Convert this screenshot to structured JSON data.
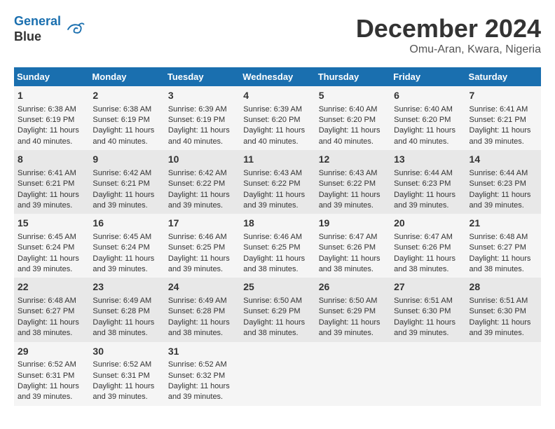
{
  "header": {
    "logo_line1": "General",
    "logo_line2": "Blue",
    "month": "December 2024",
    "location": "Omu-Aran, Kwara, Nigeria"
  },
  "days_of_week": [
    "Sunday",
    "Monday",
    "Tuesday",
    "Wednesday",
    "Thursday",
    "Friday",
    "Saturday"
  ],
  "weeks": [
    [
      {
        "day": "1",
        "lines": [
          "Sunrise: 6:38 AM",
          "Sunset: 6:19 PM",
          "Daylight: 11 hours",
          "and 40 minutes."
        ]
      },
      {
        "day": "2",
        "lines": [
          "Sunrise: 6:38 AM",
          "Sunset: 6:19 PM",
          "Daylight: 11 hours",
          "and 40 minutes."
        ]
      },
      {
        "day": "3",
        "lines": [
          "Sunrise: 6:39 AM",
          "Sunset: 6:19 PM",
          "Daylight: 11 hours",
          "and 40 minutes."
        ]
      },
      {
        "day": "4",
        "lines": [
          "Sunrise: 6:39 AM",
          "Sunset: 6:20 PM",
          "Daylight: 11 hours",
          "and 40 minutes."
        ]
      },
      {
        "day": "5",
        "lines": [
          "Sunrise: 6:40 AM",
          "Sunset: 6:20 PM",
          "Daylight: 11 hours",
          "and 40 minutes."
        ]
      },
      {
        "day": "6",
        "lines": [
          "Sunrise: 6:40 AM",
          "Sunset: 6:20 PM",
          "Daylight: 11 hours",
          "and 40 minutes."
        ]
      },
      {
        "day": "7",
        "lines": [
          "Sunrise: 6:41 AM",
          "Sunset: 6:21 PM",
          "Daylight: 11 hours",
          "and 39 minutes."
        ]
      }
    ],
    [
      {
        "day": "8",
        "lines": [
          "Sunrise: 6:41 AM",
          "Sunset: 6:21 PM",
          "Daylight: 11 hours",
          "and 39 minutes."
        ]
      },
      {
        "day": "9",
        "lines": [
          "Sunrise: 6:42 AM",
          "Sunset: 6:21 PM",
          "Daylight: 11 hours",
          "and 39 minutes."
        ]
      },
      {
        "day": "10",
        "lines": [
          "Sunrise: 6:42 AM",
          "Sunset: 6:22 PM",
          "Daylight: 11 hours",
          "and 39 minutes."
        ]
      },
      {
        "day": "11",
        "lines": [
          "Sunrise: 6:43 AM",
          "Sunset: 6:22 PM",
          "Daylight: 11 hours",
          "and 39 minutes."
        ]
      },
      {
        "day": "12",
        "lines": [
          "Sunrise: 6:43 AM",
          "Sunset: 6:22 PM",
          "Daylight: 11 hours",
          "and 39 minutes."
        ]
      },
      {
        "day": "13",
        "lines": [
          "Sunrise: 6:44 AM",
          "Sunset: 6:23 PM",
          "Daylight: 11 hours",
          "and 39 minutes."
        ]
      },
      {
        "day": "14",
        "lines": [
          "Sunrise: 6:44 AM",
          "Sunset: 6:23 PM",
          "Daylight: 11 hours",
          "and 39 minutes."
        ]
      }
    ],
    [
      {
        "day": "15",
        "lines": [
          "Sunrise: 6:45 AM",
          "Sunset: 6:24 PM",
          "Daylight: 11 hours",
          "and 39 minutes."
        ]
      },
      {
        "day": "16",
        "lines": [
          "Sunrise: 6:45 AM",
          "Sunset: 6:24 PM",
          "Daylight: 11 hours",
          "and 39 minutes."
        ]
      },
      {
        "day": "17",
        "lines": [
          "Sunrise: 6:46 AM",
          "Sunset: 6:25 PM",
          "Daylight: 11 hours",
          "and 39 minutes."
        ]
      },
      {
        "day": "18",
        "lines": [
          "Sunrise: 6:46 AM",
          "Sunset: 6:25 PM",
          "Daylight: 11 hours",
          "and 38 minutes."
        ]
      },
      {
        "day": "19",
        "lines": [
          "Sunrise: 6:47 AM",
          "Sunset: 6:26 PM",
          "Daylight: 11 hours",
          "and 38 minutes."
        ]
      },
      {
        "day": "20",
        "lines": [
          "Sunrise: 6:47 AM",
          "Sunset: 6:26 PM",
          "Daylight: 11 hours",
          "and 38 minutes."
        ]
      },
      {
        "day": "21",
        "lines": [
          "Sunrise: 6:48 AM",
          "Sunset: 6:27 PM",
          "Daylight: 11 hours",
          "and 38 minutes."
        ]
      }
    ],
    [
      {
        "day": "22",
        "lines": [
          "Sunrise: 6:48 AM",
          "Sunset: 6:27 PM",
          "Daylight: 11 hours",
          "and 38 minutes."
        ]
      },
      {
        "day": "23",
        "lines": [
          "Sunrise: 6:49 AM",
          "Sunset: 6:28 PM",
          "Daylight: 11 hours",
          "and 38 minutes."
        ]
      },
      {
        "day": "24",
        "lines": [
          "Sunrise: 6:49 AM",
          "Sunset: 6:28 PM",
          "Daylight: 11 hours",
          "and 38 minutes."
        ]
      },
      {
        "day": "25",
        "lines": [
          "Sunrise: 6:50 AM",
          "Sunset: 6:29 PM",
          "Daylight: 11 hours",
          "and 38 minutes."
        ]
      },
      {
        "day": "26",
        "lines": [
          "Sunrise: 6:50 AM",
          "Sunset: 6:29 PM",
          "Daylight: 11 hours",
          "and 39 minutes."
        ]
      },
      {
        "day": "27",
        "lines": [
          "Sunrise: 6:51 AM",
          "Sunset: 6:30 PM",
          "Daylight: 11 hours",
          "and 39 minutes."
        ]
      },
      {
        "day": "28",
        "lines": [
          "Sunrise: 6:51 AM",
          "Sunset: 6:30 PM",
          "Daylight: 11 hours",
          "and 39 minutes."
        ]
      }
    ],
    [
      {
        "day": "29",
        "lines": [
          "Sunrise: 6:52 AM",
          "Sunset: 6:31 PM",
          "Daylight: 11 hours",
          "and 39 minutes."
        ]
      },
      {
        "day": "30",
        "lines": [
          "Sunrise: 6:52 AM",
          "Sunset: 6:31 PM",
          "Daylight: 11 hours",
          "and 39 minutes."
        ]
      },
      {
        "day": "31",
        "lines": [
          "Sunrise: 6:52 AM",
          "Sunset: 6:32 PM",
          "Daylight: 11 hours",
          "and 39 minutes."
        ]
      },
      {
        "day": "",
        "lines": []
      },
      {
        "day": "",
        "lines": []
      },
      {
        "day": "",
        "lines": []
      },
      {
        "day": "",
        "lines": []
      }
    ]
  ]
}
